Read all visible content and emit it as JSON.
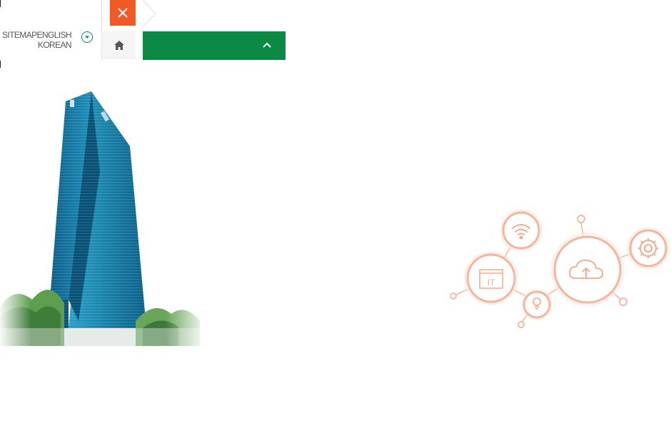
{
  "utility_links": {
    "sitemap": "SITEMAP",
    "english": "ENGLISH",
    "korean": "KOREAN"
  },
  "icons": {
    "lang_toggle": "chevron-down-circle-icon",
    "close": "close-icon",
    "home": "home-icon",
    "menu_toggle": "chevron-up-icon"
  },
  "illustration": {
    "it_label": "IT"
  },
  "colors": {
    "brand_green": "#0c8a45",
    "close_orange": "#f15a24",
    "illustration_peach": "#f7b49c"
  }
}
